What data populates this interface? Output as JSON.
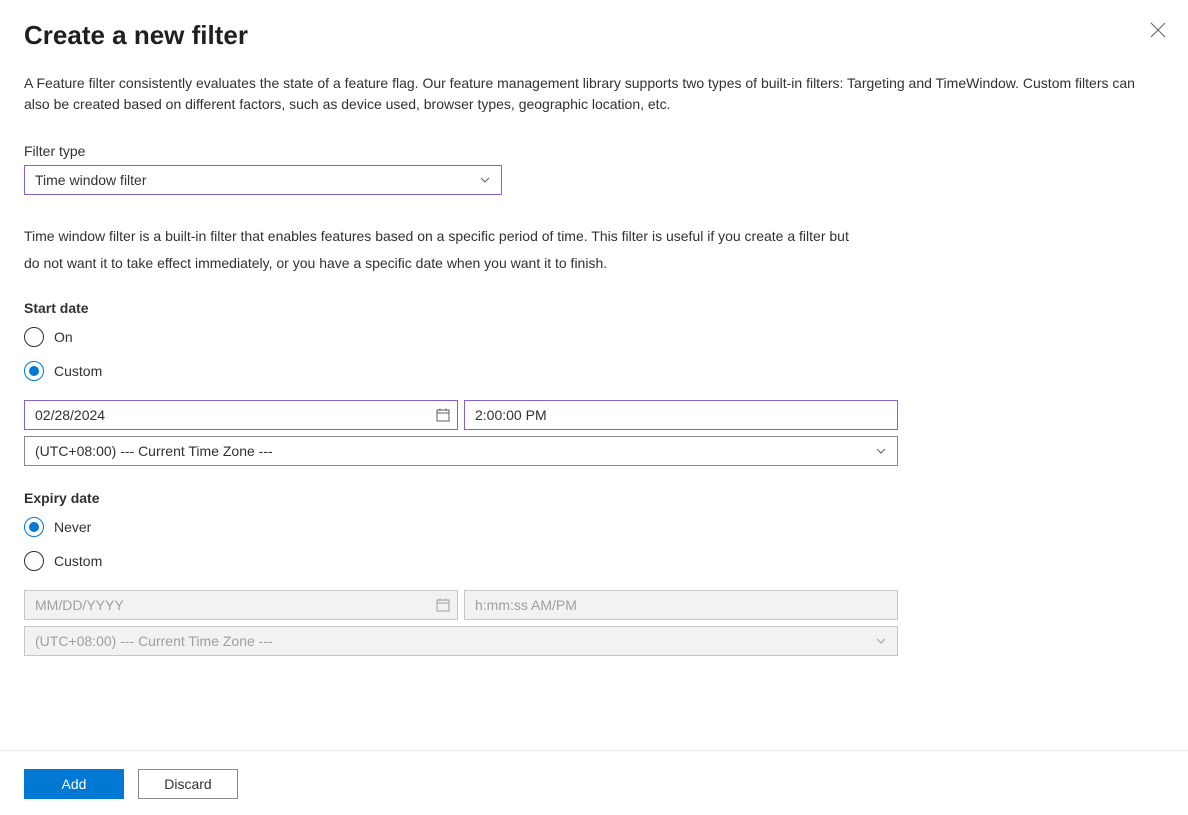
{
  "header": {
    "title": "Create a new filter"
  },
  "description": "A Feature filter consistently evaluates the state of a feature flag. Our feature management library supports two types of built-in filters: Targeting and TimeWindow. Custom filters can also be created based on different factors, such as device used, browser types, geographic location, etc.",
  "filterType": {
    "label": "Filter type",
    "value": "Time window filter"
  },
  "helpText": "Time window filter is a built-in filter that enables features based on a specific period of time. This filter is useful if you create a filter but do not want it to take effect immediately, or you have a specific date when you want it to finish.",
  "startDate": {
    "sectionLabel": "Start date",
    "options": {
      "on": "On",
      "custom": "Custom"
    },
    "selected": "custom",
    "dateValue": "02/28/2024",
    "timeValue": "2:00:00 PM",
    "timezone": "(UTC+08:00) --- Current Time Zone ---"
  },
  "expiryDate": {
    "sectionLabel": "Expiry date",
    "options": {
      "never": "Never",
      "custom": "Custom"
    },
    "selected": "never",
    "datePlaceholder": "MM/DD/YYYY",
    "timePlaceholder": "h:mm:ss AM/PM",
    "timezone": "(UTC+08:00) --- Current Time Zone ---"
  },
  "footer": {
    "add": "Add",
    "discard": "Discard"
  }
}
